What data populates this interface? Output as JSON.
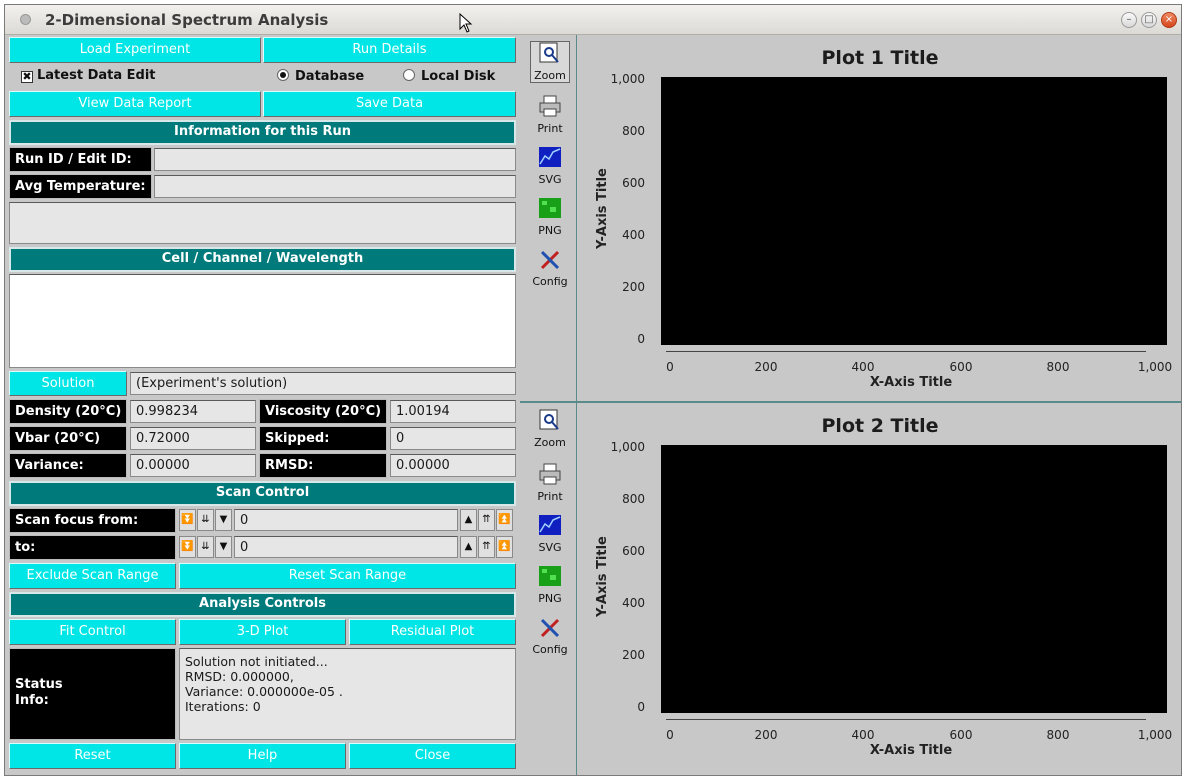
{
  "window": {
    "title": "2-Dimensional Spectrum Analysis"
  },
  "top_buttons": {
    "load": "Load Experiment",
    "run_details": "Run Details",
    "view_report": "View Data Report",
    "save": "Save Data"
  },
  "options": {
    "latest_edit": "Latest Data Edit",
    "latest_edit_checked": true,
    "database": "Database",
    "local_disk": "Local Disk",
    "selected_source": "Database"
  },
  "run_info": {
    "header": "Information for this Run",
    "run_id_label": "Run ID / Edit ID:",
    "run_id_value": "",
    "avg_temp_label": "Avg Temperature:",
    "avg_temp_value": ""
  },
  "cell": {
    "header": "Cell / Channel / Wavelength"
  },
  "solution": {
    "button": "Solution",
    "value": "(Experiment's solution)"
  },
  "params": {
    "density_label": "Density (20°C)",
    "density_value": "0.998234",
    "viscosity_label": "Viscosity (20°C)",
    "viscosity_value": "1.00194",
    "vbar_label": "Vbar (20°C)",
    "vbar_value": "0.72000",
    "skipped_label": "Skipped:",
    "skipped_value": "0",
    "variance_label": "Variance:",
    "variance_value": "0.00000",
    "rmsd_label": "RMSD:",
    "rmsd_value": "0.00000"
  },
  "scan_control": {
    "header": "Scan Control",
    "from_label": "Scan focus from:",
    "from_value": "0",
    "to_label": "to:",
    "to_value": "0",
    "exclude": "Exclude Scan Range",
    "reset": "Reset Scan Range"
  },
  "analysis": {
    "header": "Analysis Controls",
    "fit": "Fit Control",
    "plot3d": "3-D Plot",
    "residual": "Residual Plot"
  },
  "status": {
    "label_line1": "Status",
    "label_line2": "Info:",
    "line1": "Solution not initiated...",
    "line2": "RMSD:  0.000000,",
    "line3": "Variance: 0.000000e-05 .",
    "line4": "Iterations:  0"
  },
  "bottom_buttons": {
    "reset": "Reset",
    "help": "Help",
    "close": "Close"
  },
  "plot_tools": {
    "zoom": "Zoom",
    "print": "Print",
    "svg": "SVG",
    "png": "PNG",
    "config": "Config"
  },
  "plots": [
    {
      "title": "Plot 1 Title",
      "xlabel": "X-Axis Title",
      "ylabel": "Y-Axis Title",
      "y_ticks": [
        "1,000",
        "800",
        "600",
        "400",
        "200",
        "0"
      ],
      "x_ticks": [
        "0",
        "200",
        "400",
        "600",
        "800",
        "1,000"
      ]
    },
    {
      "title": "Plot 2 Title",
      "xlabel": "X-Axis Title",
      "ylabel": "Y-Axis Title",
      "y_ticks": [
        "1,000",
        "800",
        "600",
        "400",
        "200",
        "0"
      ],
      "x_ticks": [
        "0",
        "200",
        "400",
        "600",
        "800",
        "1,000"
      ]
    }
  ],
  "chart_data": [
    {
      "type": "line",
      "title": "Plot 1 Title",
      "xlabel": "X-Axis Title",
      "ylabel": "Y-Axis Title",
      "xlim": [
        0,
        1000
      ],
      "ylim": [
        0,
        1000
      ],
      "series": []
    },
    {
      "type": "line",
      "title": "Plot 2 Title",
      "xlabel": "X-Axis Title",
      "ylabel": "Y-Axis Title",
      "xlim": [
        0,
        1000
      ],
      "ylim": [
        0,
        1000
      ],
      "series": []
    }
  ],
  "colors": {
    "accent": "#00e5e5",
    "header": "#007a7a",
    "label_bg": "#000000",
    "plot_bg": "#000000"
  }
}
